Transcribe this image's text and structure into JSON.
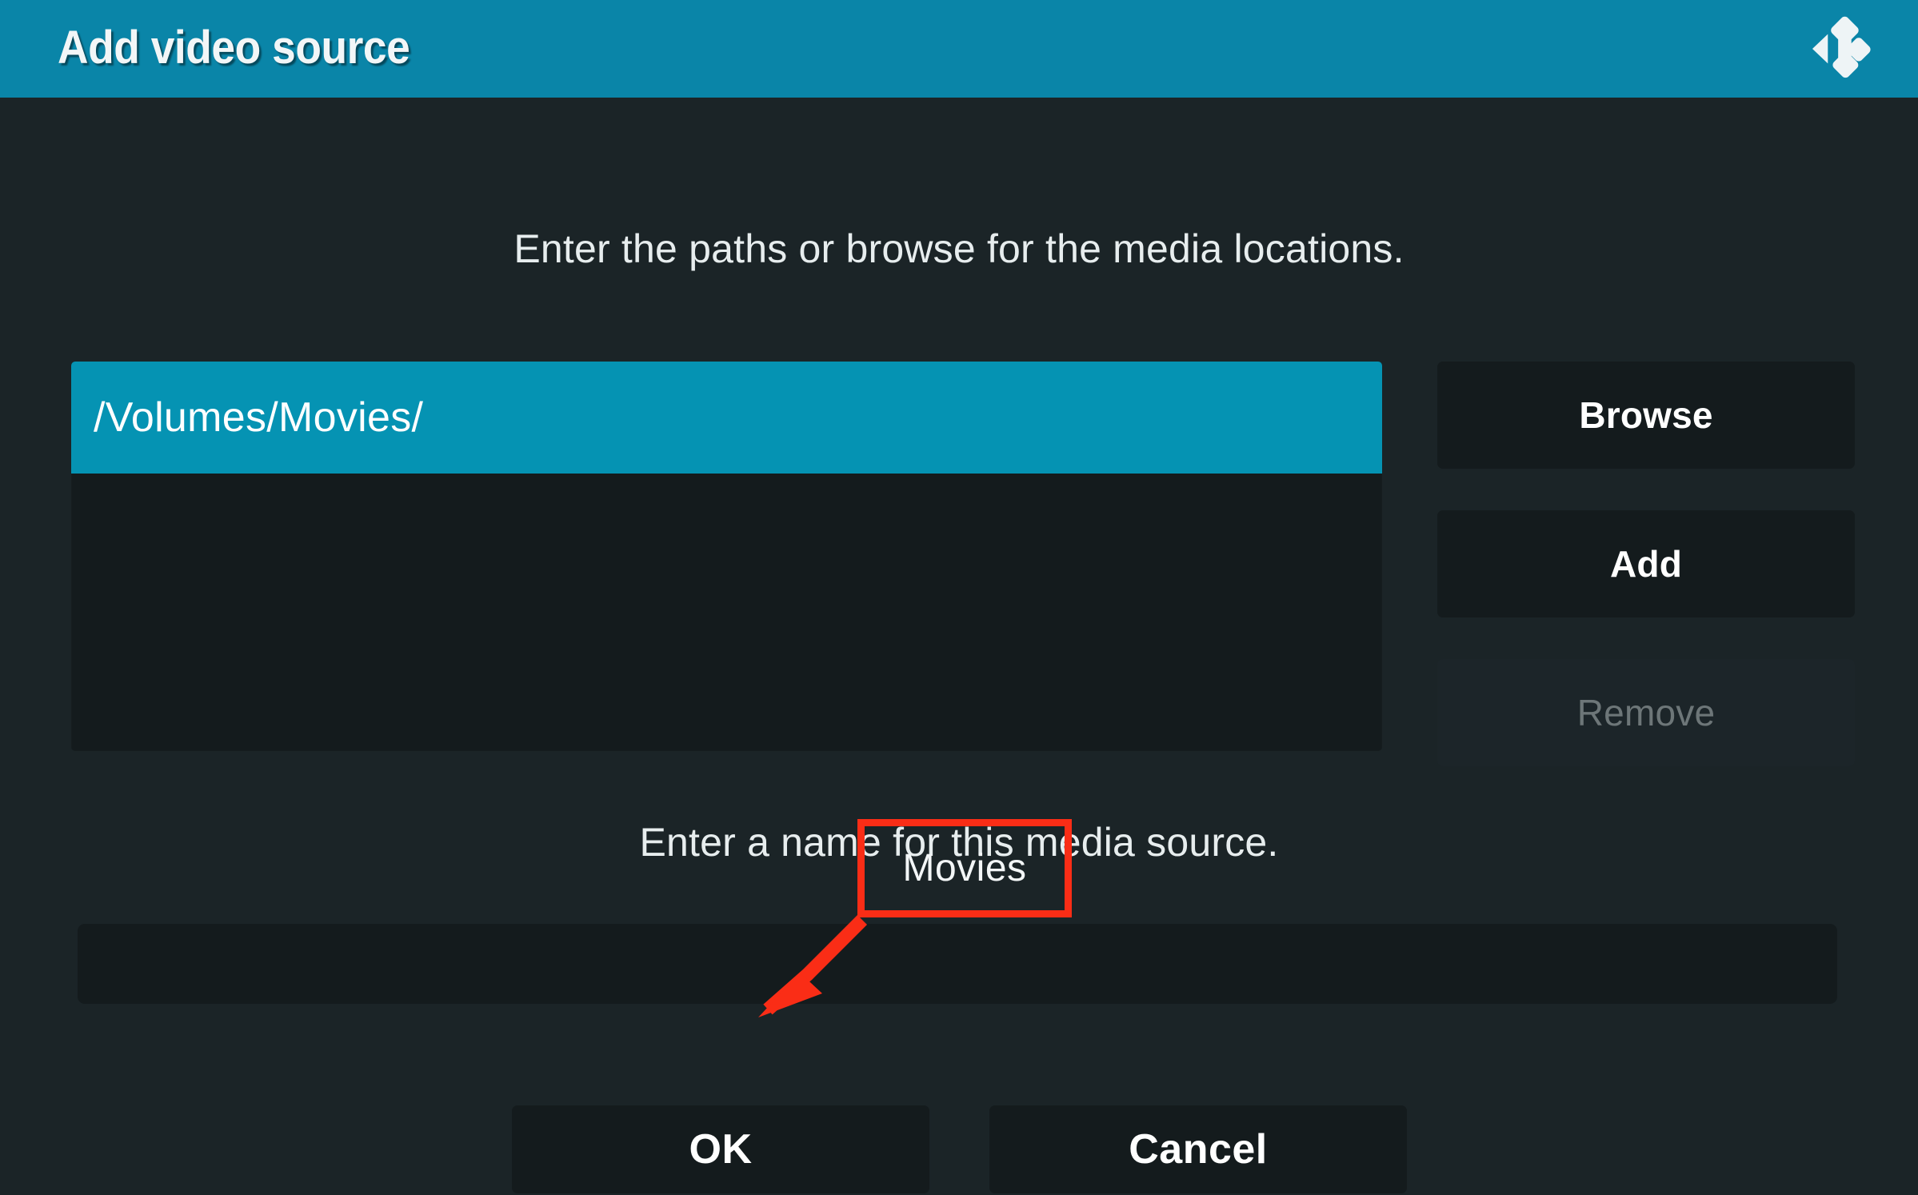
{
  "window": {
    "title": "Add video source",
    "logo_icon": "kodi-logo-icon",
    "header_color": "#0a85a8",
    "background_color": "#1b2427"
  },
  "paths_section": {
    "hint": "Enter the paths or browse for the media locations.",
    "items": [
      {
        "path": "/Volumes/Movies/",
        "selected": true
      }
    ],
    "selected_color": "#0593b3",
    "buttons": [
      {
        "label": "Browse",
        "enabled": true
      },
      {
        "label": "Add",
        "enabled": true
      },
      {
        "label": "Remove",
        "enabled": false
      }
    ]
  },
  "name_section": {
    "hint": "Enter a name for this media source.",
    "value": "Movies",
    "placeholder": ""
  },
  "dialog_buttons": [
    {
      "label": "OK"
    },
    {
      "label": "Cancel"
    }
  ],
  "annotation": {
    "highlight_text": "Movies",
    "color": "#fa2d16",
    "arrow": "points from the name field to the OK button"
  }
}
